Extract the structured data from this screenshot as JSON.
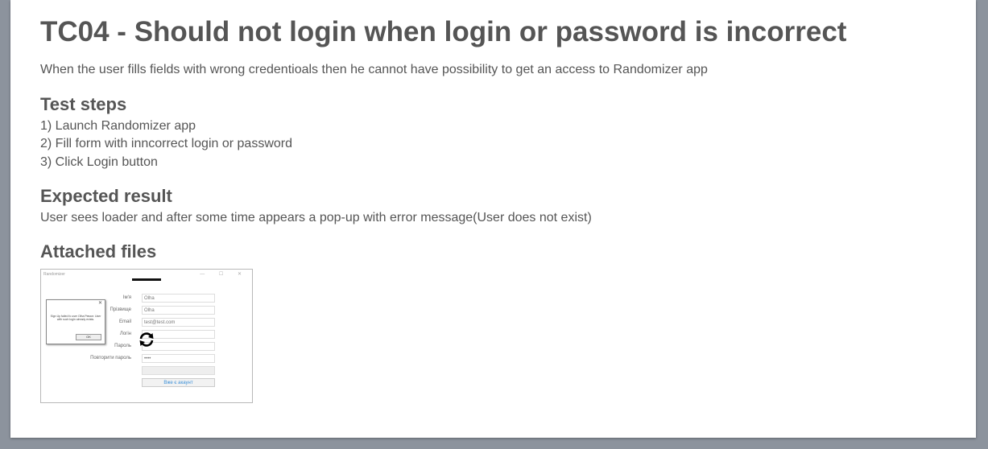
{
  "title": "TC04 - Should not login when login or password is incorrect",
  "description": "When the user fills fields with wrong credentioals then he cannot have possibility to get an access to Randomizer app",
  "test_steps": {
    "heading": "Test steps",
    "steps": [
      "1) Launch Randomizer app",
      "2) Fill form with inncorrect login or password",
      "3) Click Login button"
    ]
  },
  "expected_result": {
    "heading": "Expected result",
    "text": "User sees loader and after some time appears a pop-up with error message(User does not exist)"
  },
  "attached_files": {
    "heading": "Attached files",
    "thumbnail": {
      "window_title": "Randomizer",
      "window_buttons": "— ☐ ✕",
      "fields": [
        {
          "label": "Ім'я",
          "value": "Olha"
        },
        {
          "label": "Прізвище",
          "value": "Olha"
        },
        {
          "label": "Email",
          "value": "test@test.com"
        },
        {
          "label": "Логін",
          "value": ""
        },
        {
          "label": "Пароль",
          "value": ""
        },
        {
          "label": "Повторити пароль",
          "value": "••••"
        }
      ],
      "secondary_button": "Вже є акаунт",
      "dialog": {
        "close": "✕",
        "message": "Sign Up failed fo user Olha Ревзот. User with such login already exists.",
        "ok": "OK"
      },
      "spinner_icon": "refresh-icon"
    }
  }
}
